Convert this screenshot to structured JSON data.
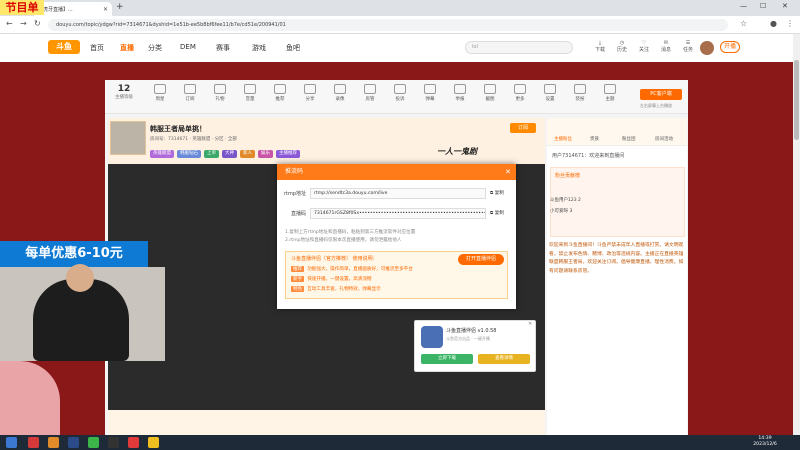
{
  "overlay_mark": "节目单",
  "browser": {
    "tab_title": "【虎牙直播】...",
    "url": "douyu.com/topic/ydgw?rid=7314671&dyshid=1e51b-ee5b8bf6fee11/b7e/cd51e/200941/01"
  },
  "site": {
    "logo": "斗鱼",
    "nav": [
      {
        "label": "首页"
      },
      {
        "label": "直播"
      },
      {
        "label": "分类"
      },
      {
        "label": "DEM"
      },
      {
        "label": "赛事"
      },
      {
        "label": "游戏"
      },
      {
        "label": "鱼吧"
      }
    ],
    "search_placeholder": "lol",
    "top_icons": [
      "下载",
      "历史",
      "关注",
      "消息",
      "任务"
    ],
    "live_btn": "开播"
  },
  "toolbar": {
    "level": "12",
    "items": [
      "主播等级",
      "周星",
      "订阅",
      "礼物",
      "音量",
      "推荐",
      "分享",
      "录像",
      "房管",
      "投诉",
      "弹幕",
      "举报",
      "截图",
      "更多",
      "设置",
      "装扮",
      "主题"
    ],
    "pc_btn": "PC客户端",
    "pc_sub": "左右屏幕上台播放"
  },
  "room": {
    "title": "韩服王者局单挑！",
    "meta": "房间号：7314671  · 英雄联盟  · 分区 · 全部",
    "tags": [
      "英雄联盟",
      "韩服钻石",
      "上单",
      "大神",
      "新人",
      "娱乐",
      "主播推荐"
    ],
    "banner": "一人一鬼剧",
    "subscribe": "订阅"
  },
  "modal": {
    "title": "推流码",
    "rtmp_label": "rtmp地址",
    "rtmp_value": "rtmp://sendtc3a.douyu.com/live",
    "key_label": "直播码",
    "key_value": "7314671rGSZ8f0Sx••••••••••••••••••••••••••••••••••••••••••••••••&qwl=0&proto=rtmp",
    "copy": "复制",
    "notes": [
      "1.复制上方rtmp地址和直播码，粘贴到第三方推流软件对应位置",
      "2.rtmp地址和直播码仅限本次直播使用，请勿泄露给他人"
    ],
    "promo_title": "斗鱼直播伴侣（官方推荐） 使用说明：",
    "promo_lines": [
      {
        "tag": "推荐",
        "text": "功能强大，操作简单，直播画质好，可推流至多平台"
      },
      {
        "tag": "新手",
        "text": "快速开播，一键设置，高清流畅"
      },
      {
        "tag": "特色",
        "text": "互动工具丰富，礼物特效，弹幕显示"
      }
    ],
    "open_btn": "打开直播伴侣"
  },
  "app_card": {
    "name": "斗鱼直播伴侣 v1.0.58",
    "sub": "斗鱼官方出品 · 一键开播",
    "btn_left": "立即下载",
    "btn_right": "查看详情"
  },
  "sidebar": {
    "tabs": [
      "主播粉丝",
      "贵族",
      "粉丝团",
      "房间活动"
    ],
    "rank_title": "粉丝贡献榜",
    "rank": [
      {
        "name": "斗鱼用户123",
        "val": "2"
      },
      {
        "name": "小可爱呀",
        "val": "3"
      }
    ],
    "chat_head": "用户7314671：欢迎来到直播间",
    "chat": "欢迎来到斗鱼直播间！斗鱼严禁未成年人直播或打赏。请文明观看，禁止发布色情、赌博、政治等违规内容。主播正在直播英雄联盟韩服王者局，欢迎关注订阅。倡导健康直播，理性消费。如有问题请联系房管。"
  },
  "streamer_overlay": {
    "promo": "每单优惠6-10元"
  },
  "taskbar": {
    "time": "14:39",
    "date": "2023/12/6"
  }
}
